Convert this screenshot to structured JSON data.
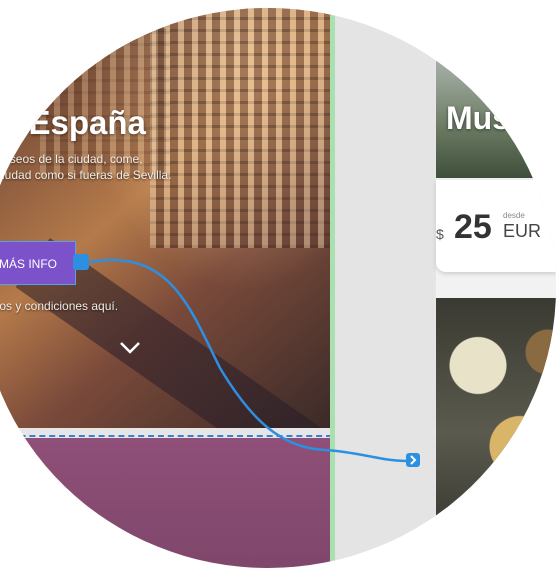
{
  "hero": {
    "title": "Madrid, España",
    "description": "Visita los museos de la ciudad, come, recorre la ciudad como si fueras de Sevilla.",
    "info_button_label": "MÁS INFO",
    "terms_text": "Términos y condiciones aquí.",
    "scroll_icon": "chevron-down-icon"
  },
  "card": {
    "title": "Museo",
    "currency_symbol": "$",
    "price": "25",
    "price_prefix": "desde",
    "currency_code": "EUR"
  },
  "colors": {
    "info_button": "#7b52c9",
    "connector": "#2d8fe0",
    "divider": "#a8e0b0",
    "lower_section": "#8f4f78"
  }
}
